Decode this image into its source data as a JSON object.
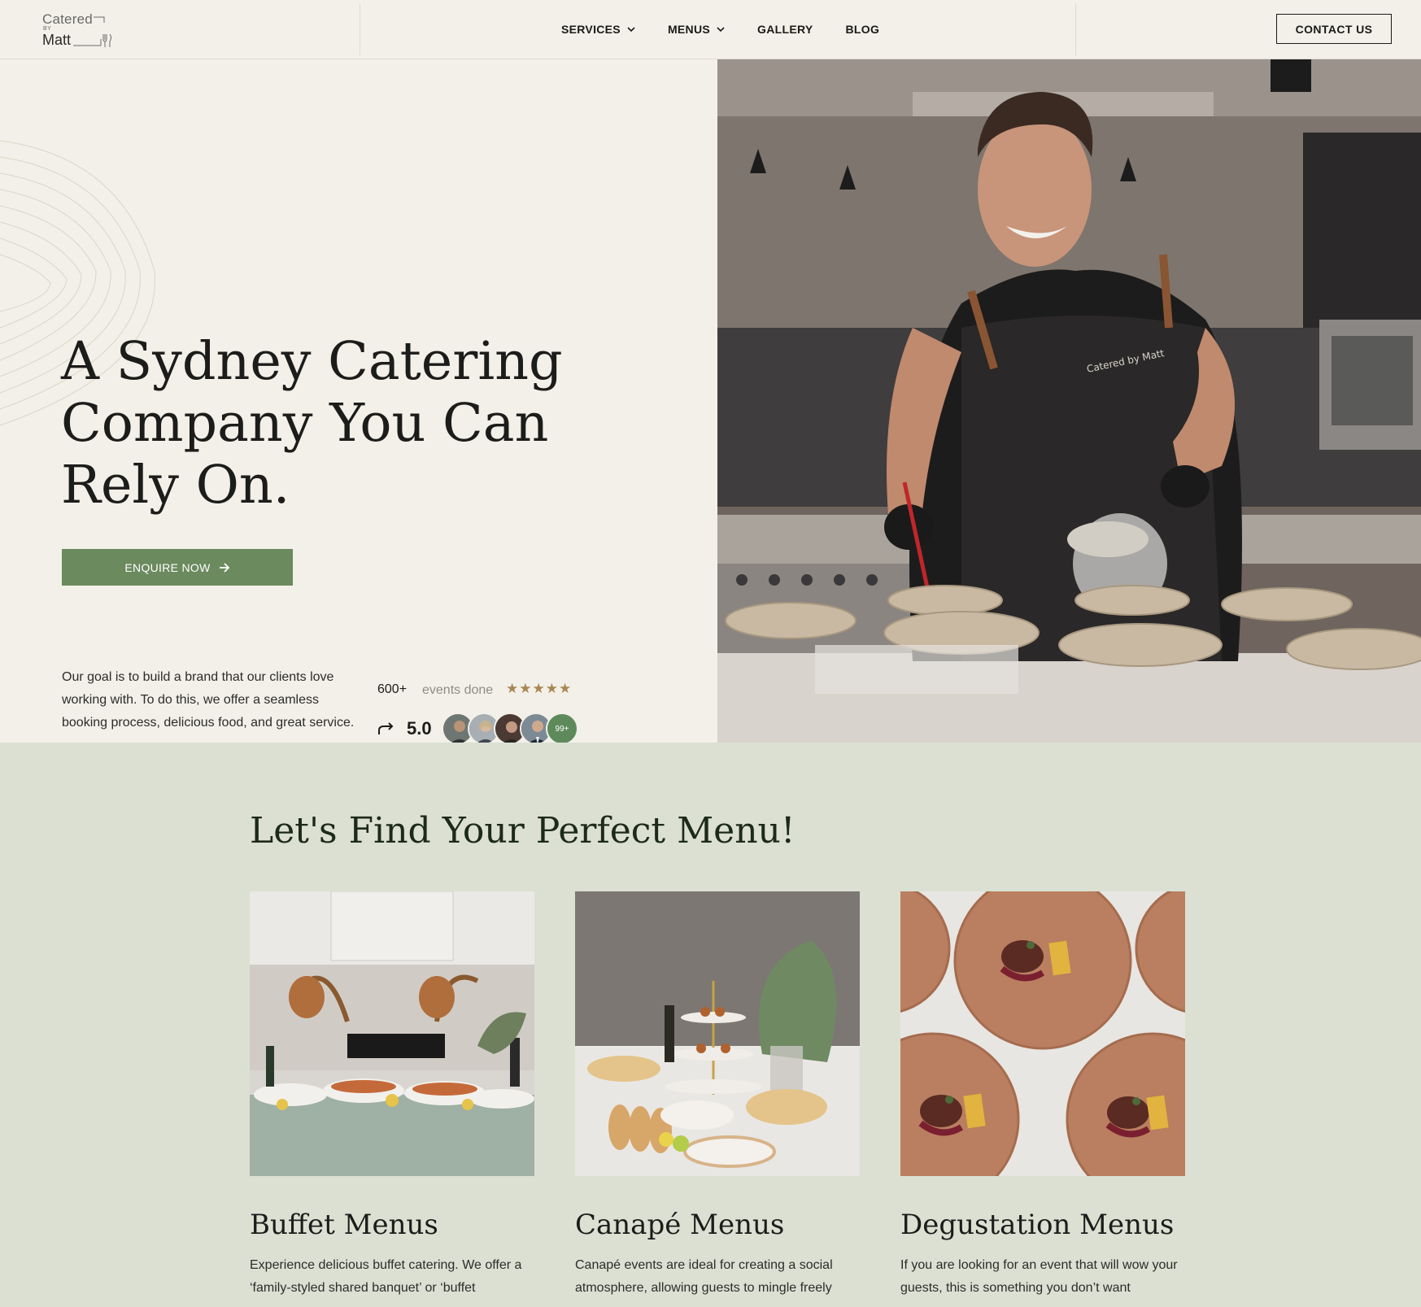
{
  "header": {
    "logo": {
      "line1": "Catered",
      "line2": "BY",
      "line3": "Matt"
    },
    "nav": [
      {
        "label": "SERVICES",
        "has_dropdown": true
      },
      {
        "label": "MENUS",
        "has_dropdown": true
      },
      {
        "label": "GALLERY",
        "has_dropdown": false
      },
      {
        "label": "BLOG",
        "has_dropdown": false
      }
    ],
    "contact_label": "CONTACT US"
  },
  "hero": {
    "title": "A Sydney Catering Company You Can Rely On.",
    "cta_label": "ENQUIRE NOW",
    "goal_text": "Our goal is to build a brand that our clients love working with. To do this, we offer a seamless booking process, delicious food, and great service.",
    "events_count": "600+",
    "events_label": "events done",
    "stars": "★★★★★",
    "rating": "5.0",
    "avatars_more": "99+",
    "apron_text": "Catered by Matt"
  },
  "menus": {
    "title": "Let's Find Your Perfect Menu!",
    "cards": [
      {
        "title": "Buffet Menus",
        "desc": "Experience delicious buffet catering. We offer a ‘family-styled shared banquet’ or ‘buffet"
      },
      {
        "title": "Canapé Menus",
        "desc": "Canapé events are ideal for creating a social atmosphere, allowing guests to mingle freely"
      },
      {
        "title": "Degustation Menus",
        "desc": "If you are looking for an event that will wow your guests, this is something you don’t want"
      }
    ]
  },
  "colors": {
    "background": "#f2f0e8",
    "accent_green": "#6b8a5e",
    "menus_bg": "#dce0d3",
    "star_gold": "#a98652"
  }
}
